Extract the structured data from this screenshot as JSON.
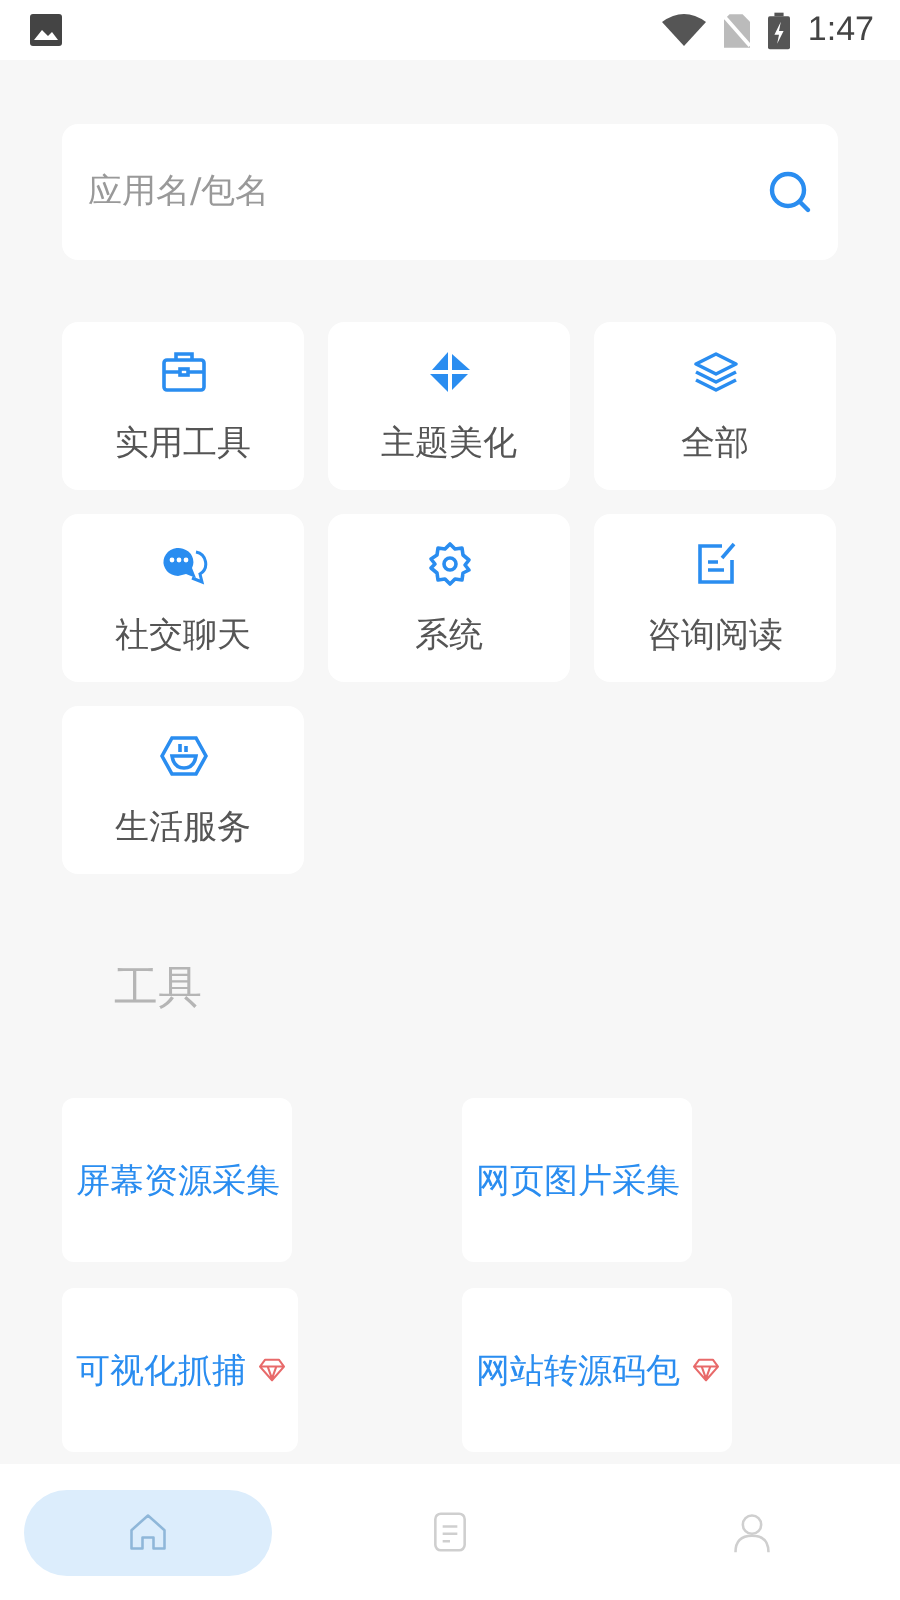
{
  "status_bar": {
    "time": "1:47"
  },
  "search": {
    "placeholder": "应用名/包名"
  },
  "categories": [
    {
      "label": "实用工具"
    },
    {
      "label": "主题美化"
    },
    {
      "label": "全部"
    },
    {
      "label": "社交聊天"
    },
    {
      "label": "系统"
    },
    {
      "label": "咨询阅读"
    },
    {
      "label": "生活服务"
    }
  ],
  "section_title": "工具",
  "tools": [
    {
      "label": "屏幕资源采集",
      "premium": false
    },
    {
      "label": "网页图片采集",
      "premium": false
    },
    {
      "label": "可视化抓捕",
      "premium": true
    },
    {
      "label": "网站转源码包",
      "premium": true
    }
  ],
  "bottom_nav": [
    {
      "selected": true
    },
    {
      "selected": false
    },
    {
      "selected": false
    }
  ]
}
